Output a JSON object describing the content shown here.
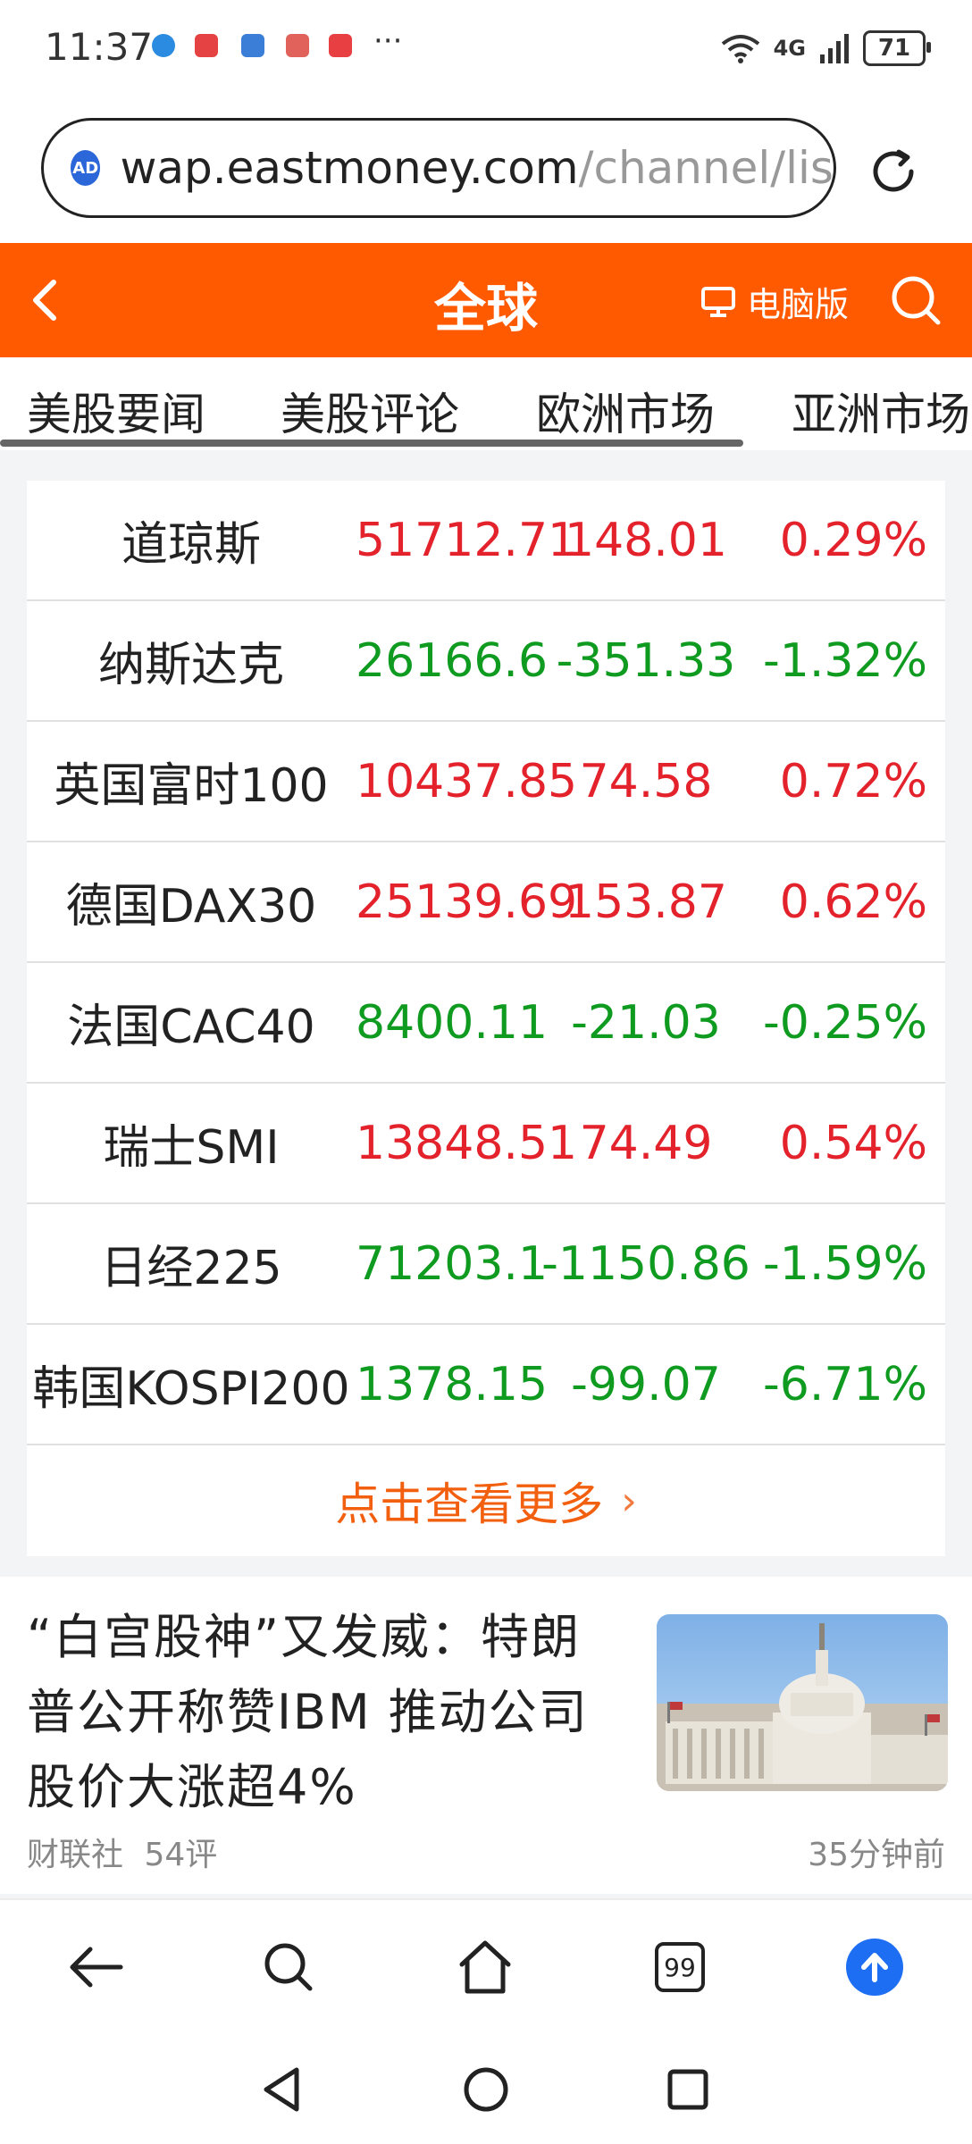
{
  "status_bar": {
    "time": "11:37",
    "network": "4G",
    "battery": "71"
  },
  "browser": {
    "ad_badge": "AD",
    "url_domain": "wap.eastmoney.com",
    "url_path": "/channel/lis"
  },
  "header": {
    "title": "全球",
    "pc_version": "电脑版"
  },
  "tabs": [
    "美股要闻",
    "美股评论",
    "欧洲市场",
    "亚洲市场"
  ],
  "indices": [
    {
      "name": "道琼斯",
      "price": "51712.71",
      "change": "148.01",
      "percent": "0.29%",
      "trend": "up"
    },
    {
      "name": "纳斯达克",
      "price": "26166.6",
      "change": "-351.33",
      "percent": "-1.32%",
      "trend": "down"
    },
    {
      "name": "英国富时100",
      "price": "10437.85",
      "change": "74.58",
      "percent": "0.72%",
      "trend": "up"
    },
    {
      "name": "德国DAX30",
      "price": "25139.69",
      "change": "153.87",
      "percent": "0.62%",
      "trend": "up"
    },
    {
      "name": "法国CAC40",
      "price": "8400.11",
      "change": "-21.03",
      "percent": "-0.25%",
      "trend": "down"
    },
    {
      "name": "瑞士SMI",
      "price": "13848.51",
      "change": "74.49",
      "percent": "0.54%",
      "trend": "up"
    },
    {
      "name": "日经225",
      "price": "71203.1",
      "change": "-1150.86",
      "percent": "-1.59%",
      "trend": "down"
    },
    {
      "name": "韩国KOSPI200",
      "price": "1378.15",
      "change": "-99.07",
      "percent": "-6.71%",
      "trend": "down"
    }
  ],
  "more_label": "点击查看更多",
  "news": {
    "title": "“白宫股神”又发威：特朗普公开称赞IBM 推动公司股价大涨超4%",
    "source": "财联社",
    "comments": "54评",
    "time": "35分钟前"
  },
  "bottom_bar": {
    "tabs_count": "99"
  },
  "colors": {
    "header_orange": "#ff5a00",
    "up_red": "#e3222c",
    "down_green": "#0f9a20",
    "more_orange": "#f25f0e",
    "accent_blue": "#1e6ef3"
  }
}
